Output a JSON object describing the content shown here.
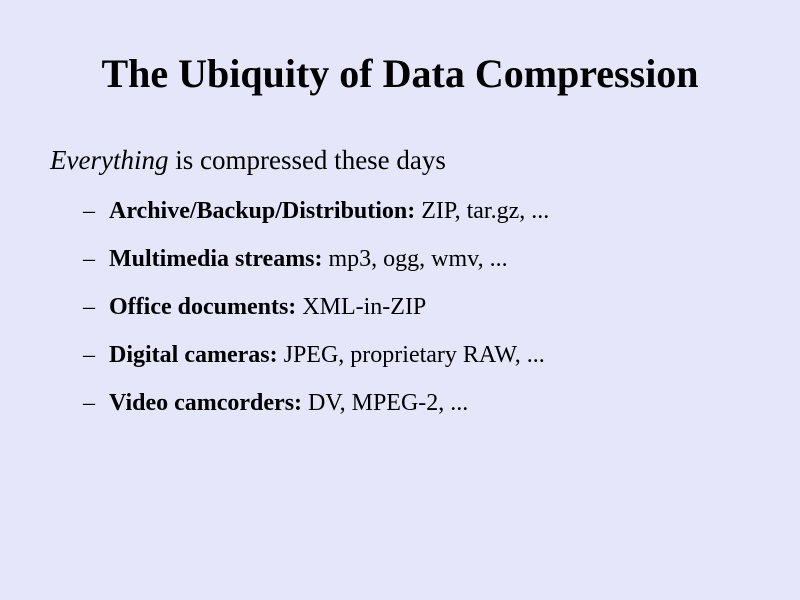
{
  "slide": {
    "title": "The Ubiquity of Data Compression",
    "lead": {
      "emphasis": "Everything",
      "rest": " is compressed these days"
    },
    "bullet_marker": "–",
    "items": [
      {
        "label": "Archive/Backup/Distribution:",
        "text": " ZIP, tar.gz, ..."
      },
      {
        "label": "Multimedia streams:",
        "text": " mp3, ogg, wmv, ..."
      },
      {
        "label": "Office documents:",
        "text": " XML-in-ZIP"
      },
      {
        "label": "Digital cameras:",
        "text": " JPEG, proprietary RAW, ..."
      },
      {
        "label": "Video camcorders:",
        "text": " DV, MPEG-2, ..."
      }
    ]
  },
  "colors": {
    "background": "#e6e6fa",
    "text": "#000000"
  }
}
